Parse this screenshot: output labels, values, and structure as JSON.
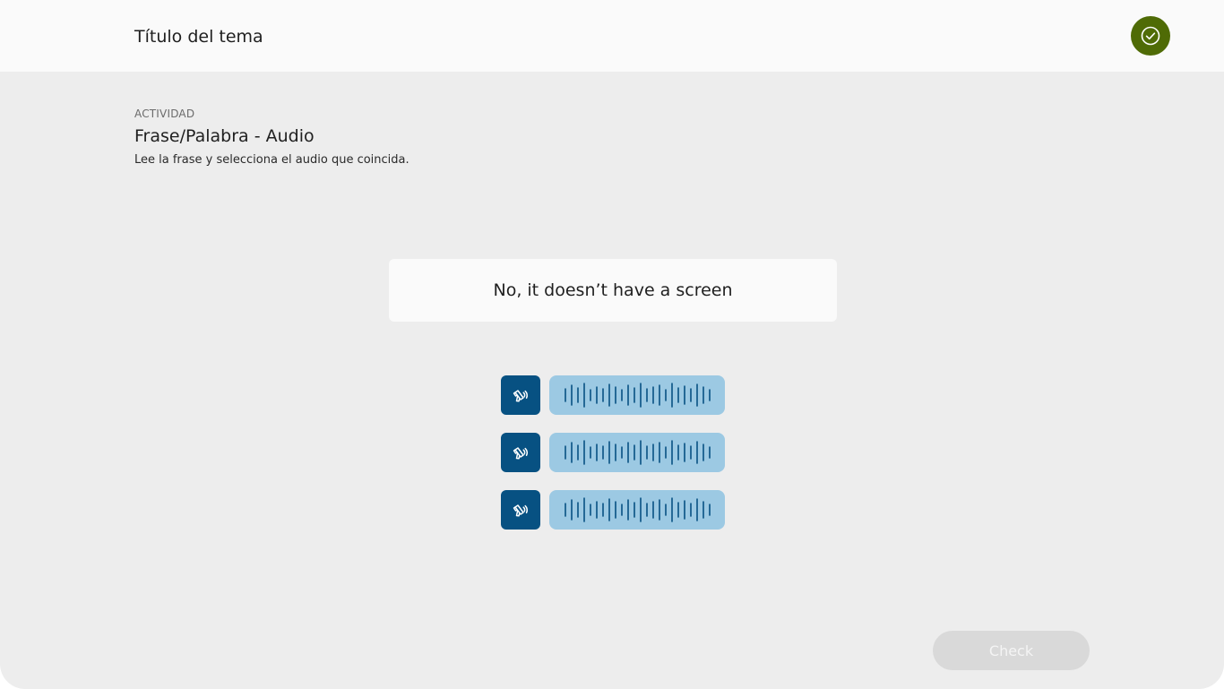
{
  "header": {
    "title": "Título del tema",
    "done_icon": "check-circle-icon",
    "done_color": "#4f6b06"
  },
  "activity": {
    "kicker": "ACTIVIDAD",
    "title": "Frase/Palabra - Audio",
    "instructions": "Lee la frase y selecciona el audio que coincida."
  },
  "phrase": {
    "text": "No, it doesn’t have a screen"
  },
  "audio_options": [
    {
      "play_icon": "speaker-icon",
      "wave_icon": "waveform-icon"
    },
    {
      "play_icon": "speaker-icon",
      "wave_icon": "waveform-icon"
    },
    {
      "play_icon": "speaker-icon",
      "wave_icon": "waveform-icon"
    }
  ],
  "colors": {
    "play_button": "#075182",
    "waveform_bg": "#9cc9e3",
    "waveform_bars": "#075182"
  },
  "footer": {
    "check_label": "Check"
  }
}
